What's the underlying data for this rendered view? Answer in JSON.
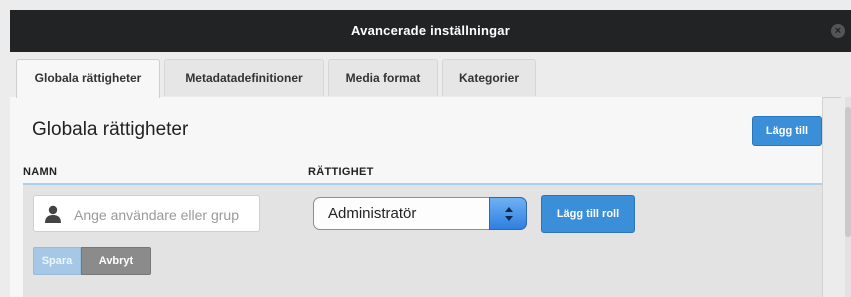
{
  "window": {
    "title": "Avancerade inställningar",
    "close_glyph": "×",
    "close_icon": "close-icon"
  },
  "tabs": [
    {
      "label": "Globala rättigheter",
      "active": true
    },
    {
      "label": "Metadatadefinitioner",
      "active": false
    },
    {
      "label": "Media format",
      "active": false
    },
    {
      "label": "Kategorier",
      "active": false
    }
  ],
  "main": {
    "heading": "Globala rättigheter",
    "add_button": "Lägg till",
    "columns": {
      "name": "NAMN",
      "permission": "RÄTTIGHET"
    },
    "user_input": {
      "placeholder": "Ange användare eller grup",
      "value": "",
      "icon": "person-icon"
    },
    "permission_select": {
      "value": "Administratör",
      "icon": "stepper-arrows-icon"
    },
    "add_role_button": "Lägg till roll",
    "save_button": "Spara",
    "cancel_button": "Avbryt"
  },
  "colors": {
    "accent": "#3b8fd9",
    "titlebar": "#222325",
    "disabled_save": "#a6c8e6",
    "cancel": "#8b8b8b"
  }
}
